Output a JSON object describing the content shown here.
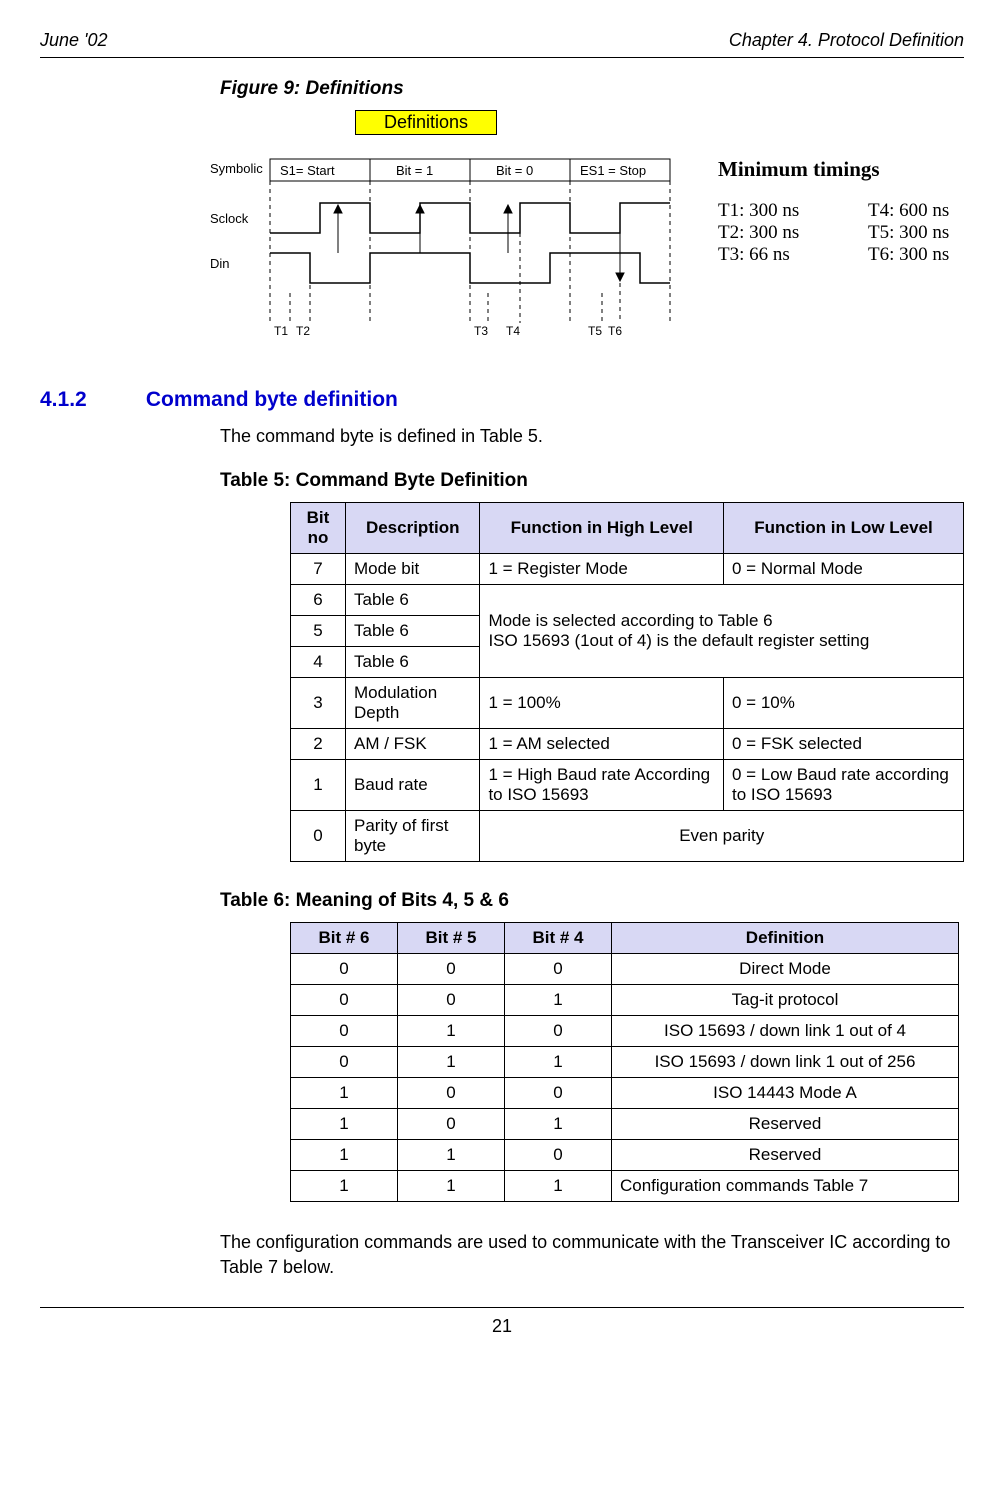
{
  "header": {
    "left": "June '02",
    "right": "Chapter 4. Protocol Definition"
  },
  "figure": {
    "caption": "Figure 9: Definitions",
    "box_label": "Definitions",
    "labels": {
      "symbolic": "Symbolic",
      "sclock": "Sclock",
      "din": "Din",
      "s1_start": "S1= Start",
      "bit1": "Bit = 1",
      "bit0": "Bit = 0",
      "es1_stop": "ES1 = Stop",
      "t1": "T1",
      "t2": "T2",
      "t3": "T3",
      "t4": "T4",
      "t5": "T5",
      "t6": "T6"
    },
    "timings": {
      "title": "Minimum timings",
      "t1": "T1: 300 ns",
      "t2": "T2: 300 ns",
      "t3": "T3: 66 ns",
      "t4": "T4: 600 ns",
      "t5": "T5: 300 ns",
      "t6": "T6: 300 ns"
    }
  },
  "section": {
    "num": "4.1.2",
    "title": "Command byte definition",
    "intro": "The command byte is defined in Table 5."
  },
  "table5": {
    "caption": "Table 5: Command Byte Definition",
    "headers": [
      "Bit no",
      "Description",
      "Function in High Level",
      "Function in Low Level"
    ],
    "row7": {
      "bitno": "7",
      "desc": "Mode bit",
      "high": "1 = Register Mode",
      "low": "0 = Normal Mode"
    },
    "row6": {
      "bitno": "6",
      "desc": "Table 6"
    },
    "row5": {
      "bitno": "5",
      "desc": "Table 6"
    },
    "row4": {
      "bitno": "4",
      "desc": "Table 6"
    },
    "mode_note": "Mode is selected according to Table 6\nISO 15693 (1out of 4) is the default register setting",
    "row3": {
      "bitno": "3",
      "desc": "Modulation Depth",
      "high": "1 = 100%",
      "low": "0 = 10%"
    },
    "row2": {
      "bitno": "2",
      "desc": "AM / FSK",
      "high": "1 = AM selected",
      "low": "0 = FSK selected"
    },
    "row1": {
      "bitno": "1",
      "desc": "Baud rate",
      "high": "1 = High Baud rate According to ISO 15693",
      "low": "0 = Low Baud rate according to ISO 15693"
    },
    "row0": {
      "bitno": "0",
      "desc": "Parity of first byte",
      "func": "Even parity"
    }
  },
  "table6": {
    "caption": "Table 6: Meaning of Bits 4, 5 & 6",
    "headers": [
      "Bit # 6",
      "Bit # 5",
      "Bit # 4",
      "Definition"
    ],
    "rows": [
      {
        "b6": "0",
        "b5": "0",
        "b4": "0",
        "def": "Direct Mode"
      },
      {
        "b6": "0",
        "b5": "0",
        "b4": "1",
        "def": "Tag-it protocol"
      },
      {
        "b6": "0",
        "b5": "1",
        "b4": "0",
        "def": "ISO 15693 / down link 1 out of 4"
      },
      {
        "b6": "0",
        "b5": "1",
        "b4": "1",
        "def": "ISO 15693 / down link 1 out of 256"
      },
      {
        "b6": "1",
        "b5": "0",
        "b4": "0",
        "def": "ISO 14443 Mode A"
      },
      {
        "b6": "1",
        "b5": "0",
        "b4": "1",
        "def": "Reserved"
      },
      {
        "b6": "1",
        "b5": "1",
        "b4": "0",
        "def": "Reserved"
      },
      {
        "b6": "1",
        "b5": "1",
        "b4": "1",
        "def": "Configuration commands Table 7"
      }
    ]
  },
  "closing": "The configuration commands are used to communicate with the Transceiver IC according to Table 7 below.",
  "page_number": "21"
}
